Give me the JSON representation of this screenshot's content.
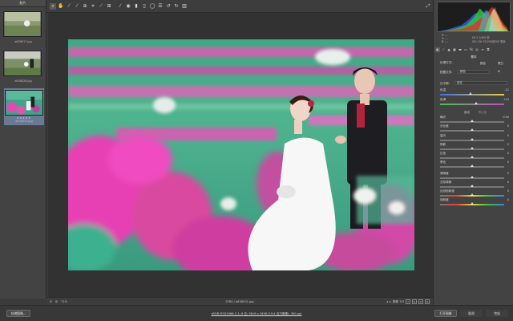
{
  "filmstrip": {
    "header": "胶片",
    "items": [
      {
        "name": "a636017.jpg"
      },
      {
        "name": "a636026.jpg"
      },
      {
        "name": "a636031.jpg",
        "selected": true,
        "rating": "★★★★★"
      }
    ]
  },
  "toolbar": {
    "tools": [
      "zoom-icon",
      "hand-icon",
      "white-balance-icon",
      "color-sampler-icon",
      "target-adjust-icon",
      "crop-icon",
      "straighten-icon",
      "transform-icon",
      "spot-removal-icon",
      "red-eye-icon",
      "adjustment-brush-icon",
      "graduated-filter-icon",
      "radial-filter-icon",
      "preferences-icon",
      "rotate-left-icon",
      "rotate-right-icon",
      "trash-icon"
    ]
  },
  "canvas_bar": {
    "zoom": "71%",
    "filename": "2FB0 / a636031.jpg",
    "page": "图像 3/3"
  },
  "panel": {
    "info_left": [
      "R: ---",
      "G: ---",
      "B: ---"
    ],
    "info_right": [
      "f/4.5  1/400 秒",
      "ISO 100  70-200@200 毫米"
    ],
    "section_basic": "基本",
    "treatment_label": "处理方式:",
    "treatment_color": "颜色",
    "treatment_bw": "黑白",
    "profile_label": "配置文件:",
    "profile_value": "颜色",
    "wb_label": "白平衡:",
    "wb_value": "自定",
    "temp_label": "色温",
    "temp_value": "-11",
    "tint_label": "色调",
    "tint_value": "+10",
    "auto": "自动",
    "default": "默认值",
    "sliders": [
      {
        "label": "曝光",
        "value": "0.00"
      },
      {
        "label": "对比度",
        "value": "0"
      },
      {
        "label": "高光",
        "value": "0"
      },
      {
        "label": "阴影",
        "value": "0"
      },
      {
        "label": "白色",
        "value": "0"
      },
      {
        "label": "黑色",
        "value": "0"
      },
      {
        "label": "清晰度",
        "value": "0"
      },
      {
        "label": "去除薄雾",
        "value": "0"
      },
      {
        "label": "自然饱和度",
        "value": "0"
      },
      {
        "label": "饱和度",
        "value": "0"
      }
    ]
  },
  "bottom": {
    "save_button": "存储图像...",
    "workflow_link": "sRGB IEC61966-2.1; 8 位; 5616 x 3456 (19.4 百万像素); 300 ppi",
    "open_button": "打开图像",
    "cancel_button": "取消",
    "done_button": "完成"
  }
}
